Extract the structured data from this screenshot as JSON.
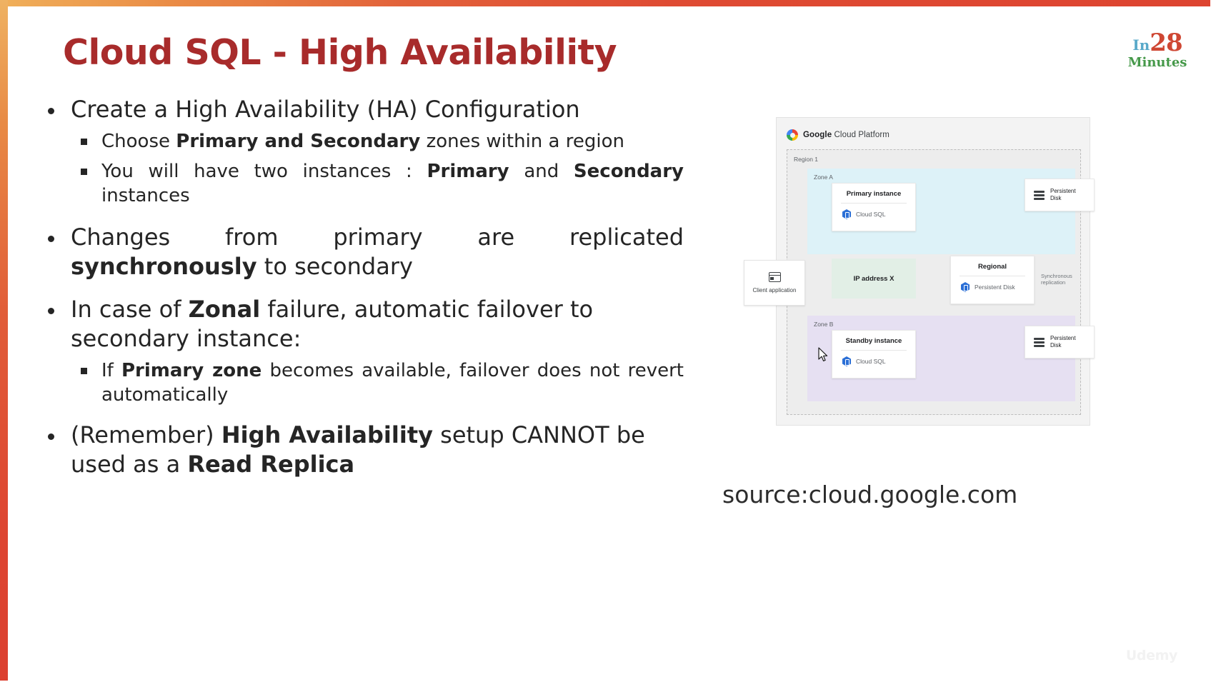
{
  "slide": {
    "title": "Cloud SQL - High Availability",
    "title_color": "#a82b2b",
    "frame_accent_color": "#dd4430"
  },
  "brand": {
    "in": "In",
    "number": "28",
    "minutes": "Minutes",
    "in_color": "#59a9c9",
    "number_color": "#cf4733",
    "minutes_color": "#46994a"
  },
  "bullets": [
    {
      "level": 1,
      "segments": [
        {
          "text": "Create a High Availability (HA) Configuration",
          "bold": false
        }
      ]
    },
    {
      "level": 2,
      "segments": [
        {
          "text": "Choose ",
          "bold": false
        },
        {
          "text": "Primary and Secondary",
          "bold": true
        },
        {
          "text": " zones within a region",
          "bold": false
        }
      ]
    },
    {
      "level": 2,
      "segments": [
        {
          "text": "You will have two instances : ",
          "bold": false
        },
        {
          "text": "Primary",
          "bold": true
        },
        {
          "text": " and ",
          "bold": false
        },
        {
          "text": "Secondary",
          "bold": true
        },
        {
          "text": " instances",
          "bold": false
        }
      ]
    },
    {
      "level": 1,
      "segments": [
        {
          "text": "Changes from primary are replicated ",
          "bold": false
        },
        {
          "text": "synchronously",
          "bold": true
        },
        {
          "text": " to secondary",
          "bold": false
        }
      ]
    },
    {
      "level": 1,
      "segments": [
        {
          "text": "In case of ",
          "bold": false
        },
        {
          "text": "Zonal",
          "bold": true
        },
        {
          "text": " failure, automatic failover to secondary instance:",
          "bold": false
        }
      ]
    },
    {
      "level": 2,
      "segments": [
        {
          "text": "If ",
          "bold": false
        },
        {
          "text": "Primary zone",
          "bold": true
        },
        {
          "text": " becomes available, failover does not revert automatically",
          "bold": false
        }
      ]
    },
    {
      "level": 1,
      "segments": [
        {
          "text": "(Remember) ",
          "bold": false
        },
        {
          "text": "High Availability",
          "bold": true
        },
        {
          "text": " setup CANNOT be used as a ",
          "bold": false
        },
        {
          "text": "Read Replica",
          "bold": true
        }
      ]
    }
  ],
  "diagram": {
    "header_prefix": "Google",
    "header_suffix": " Cloud Platform",
    "region_label": "Region 1",
    "zone_a_label": "Zone A",
    "zone_b_label": "Zone B",
    "zone_a_color": "#ddf2f8",
    "zone_b_color": "#e6e0f2",
    "primary_instance": {
      "title": "Primary instance",
      "sub": "Cloud SQL"
    },
    "standby_instance": {
      "title": "Standby instance",
      "sub": "Cloud SQL"
    },
    "regional_node": {
      "title": "Regional",
      "sub": "Persistent Disk"
    },
    "ip_address": "IP address X",
    "client_application": "Client application",
    "disk_primary_line1": "Persistent",
    "disk_primary_line2": "Disk",
    "disk_standby_line1": "Persistent",
    "disk_standby_line2": "Disk",
    "sync_replication_label": "Synchronous replication"
  },
  "caption": {
    "source": "source:cloud.google.com"
  },
  "watermark": {
    "text": "Udemy"
  }
}
